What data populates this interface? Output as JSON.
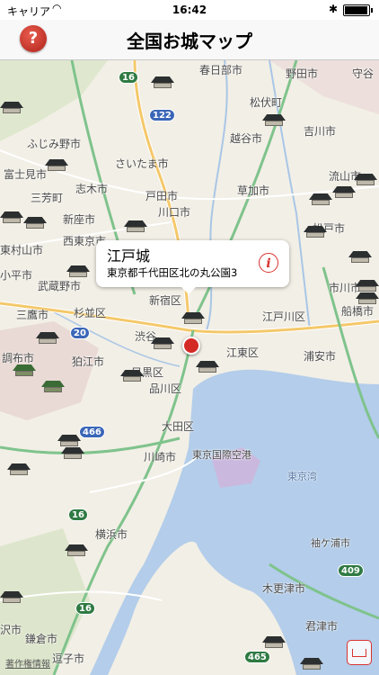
{
  "status_bar": {
    "carrier": "キャリア",
    "time": "16:42",
    "wifi_icon": "wifi-icon",
    "bluetooth_icon": "bluetooth-icon",
    "battery_icon": "battery-icon"
  },
  "nav": {
    "title": "全国お城マップ",
    "help_symbol": "?",
    "help_icon": "help-icon"
  },
  "map": {
    "place_labels": [
      {
        "id": "kasukabe",
        "text": "春日部市"
      },
      {
        "id": "noda",
        "text": "野田市"
      },
      {
        "id": "moriya",
        "text": "守谷"
      },
      {
        "id": "fujimino",
        "text": "ふじみ野市"
      },
      {
        "id": "matsubushi",
        "text": "松伏町"
      },
      {
        "id": "koshigaya",
        "text": "越谷市"
      },
      {
        "id": "yoshikawa",
        "text": "吉川市"
      },
      {
        "id": "saitama",
        "text": "さいたま市"
      },
      {
        "id": "fujimi",
        "text": "富士見市"
      },
      {
        "id": "miyoshi",
        "text": "三芳町"
      },
      {
        "id": "shiki",
        "text": "志木市"
      },
      {
        "id": "toda",
        "text": "戸田市"
      },
      {
        "id": "soka",
        "text": "草加市"
      },
      {
        "id": "nagareyama",
        "text": "流山市"
      },
      {
        "id": "kawaguchi",
        "text": "川口市"
      },
      {
        "id": "niiza",
        "text": "新座市"
      },
      {
        "id": "higashimurayama",
        "text": "東村山市"
      },
      {
        "id": "nishitokyo",
        "text": "西東京市"
      },
      {
        "id": "matsudo",
        "text": "松戸市"
      },
      {
        "id": "kodaira",
        "text": "小平市"
      },
      {
        "id": "musashino",
        "text": "武蔵野市"
      },
      {
        "id": "ichikawa",
        "text": "市川市"
      },
      {
        "id": "shinjuku",
        "text": "新宿区"
      },
      {
        "id": "mitaka",
        "text": "三鷹市"
      },
      {
        "id": "suginami",
        "text": "杉並区"
      },
      {
        "id": "edogawa",
        "text": "江戸川区"
      },
      {
        "id": "funabashi",
        "text": "船橋市"
      },
      {
        "id": "shibuya",
        "text": "渋谷"
      },
      {
        "id": "koto",
        "text": "江東区"
      },
      {
        "id": "urayasu",
        "text": "浦安市"
      },
      {
        "id": "chofu",
        "text": "調布市"
      },
      {
        "id": "komae",
        "text": "狛江市"
      },
      {
        "id": "meguro",
        "text": "目黒区"
      },
      {
        "id": "shinagawa",
        "text": "品川区"
      },
      {
        "id": "ota",
        "text": "大田区"
      },
      {
        "id": "haneda",
        "text": "東京国際空港"
      },
      {
        "id": "kawasaki",
        "text": "川崎市"
      },
      {
        "id": "yokohama",
        "text": "横浜市"
      },
      {
        "id": "sodegaura",
        "text": "袖ケ浦市"
      },
      {
        "id": "kisarazu",
        "text": "木更津市"
      },
      {
        "id": "kimitsu",
        "text": "君津市"
      },
      {
        "id": "kamakura",
        "text": "鎌倉市"
      },
      {
        "id": "zushi",
        "text": "逗子市"
      },
      {
        "id": "fujisawa",
        "text": "沢市"
      },
      {
        "id": "tokyo_bay",
        "text": "東京湾"
      }
    ],
    "road_shields": [
      "16",
      "122",
      "20",
      "466",
      "16",
      "16",
      "409",
      "465"
    ],
    "callout": {
      "name": "江戸城",
      "address": "東京都千代田区北の丸公園3",
      "info_symbol": "i",
      "info_icon": "info-icon"
    },
    "pin_icon": "location-pin-icon",
    "castle_icon": "castle-marker-icon",
    "copyright": "著作権情報",
    "tracking_icon": "tracking-icon"
  }
}
